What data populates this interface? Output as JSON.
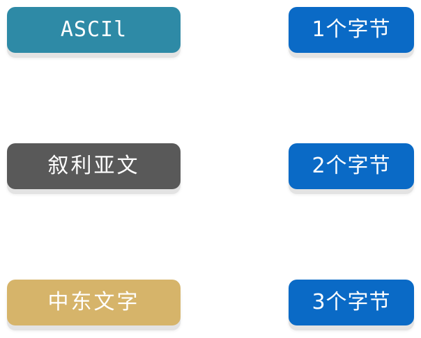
{
  "rows": [
    {
      "encoding": "ASCIl",
      "bytes": "1个字节",
      "color": "#2e8aa6"
    },
    {
      "encoding": "叙利亚文",
      "bytes": "2个字节",
      "color": "#595959"
    },
    {
      "encoding": "中东文字",
      "bytes": "3个字节",
      "color": "#d6b46a"
    }
  ],
  "colors": {
    "bytes_badge": "#0a6ac6",
    "background": "#ffffff"
  }
}
